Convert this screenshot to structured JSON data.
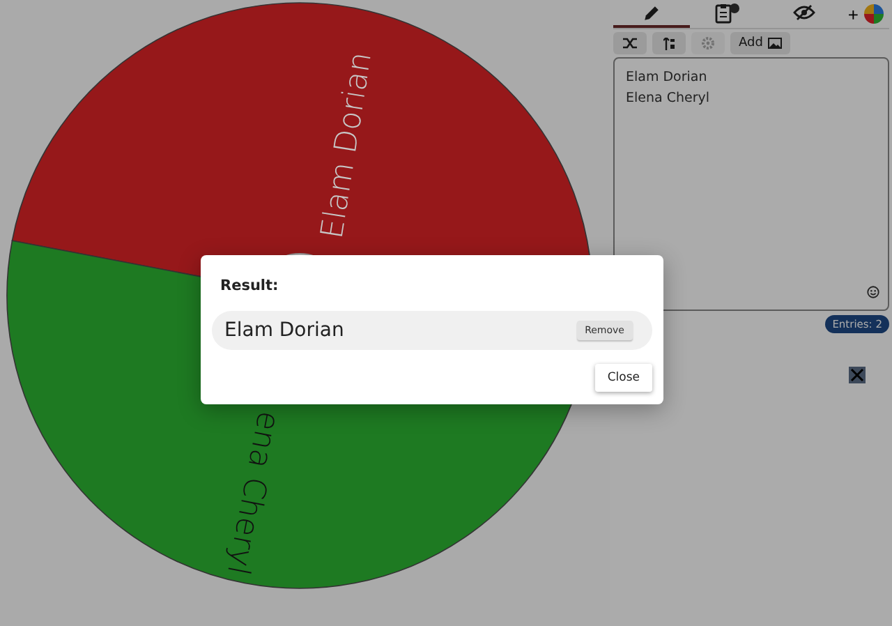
{
  "wheel": {
    "segments": [
      {
        "label": "Elam Dorian",
        "color": "#96181a"
      },
      {
        "label": "ena Cheryl",
        "color": "#1e7a22"
      }
    ]
  },
  "tabs": [
    {
      "kind": "edit",
      "selected": true
    },
    {
      "kind": "results",
      "selected": false
    },
    {
      "kind": "hide",
      "selected": false
    }
  ],
  "add_label": "+",
  "toolbar": [
    {
      "kind": "shuffle",
      "disabled": false
    },
    {
      "kind": "sort",
      "disabled": false
    },
    {
      "kind": "settings",
      "disabled": true
    },
    {
      "kind": "image",
      "label": "Add",
      "disabled": false
    }
  ],
  "entries": [
    "Elam Dorian",
    "Elena Cheryl"
  ],
  "entries_count": "Entries: 2",
  "dialog": {
    "title": "Result:",
    "result": "Elam Dorian",
    "remove": "Remove",
    "close": "Close"
  }
}
